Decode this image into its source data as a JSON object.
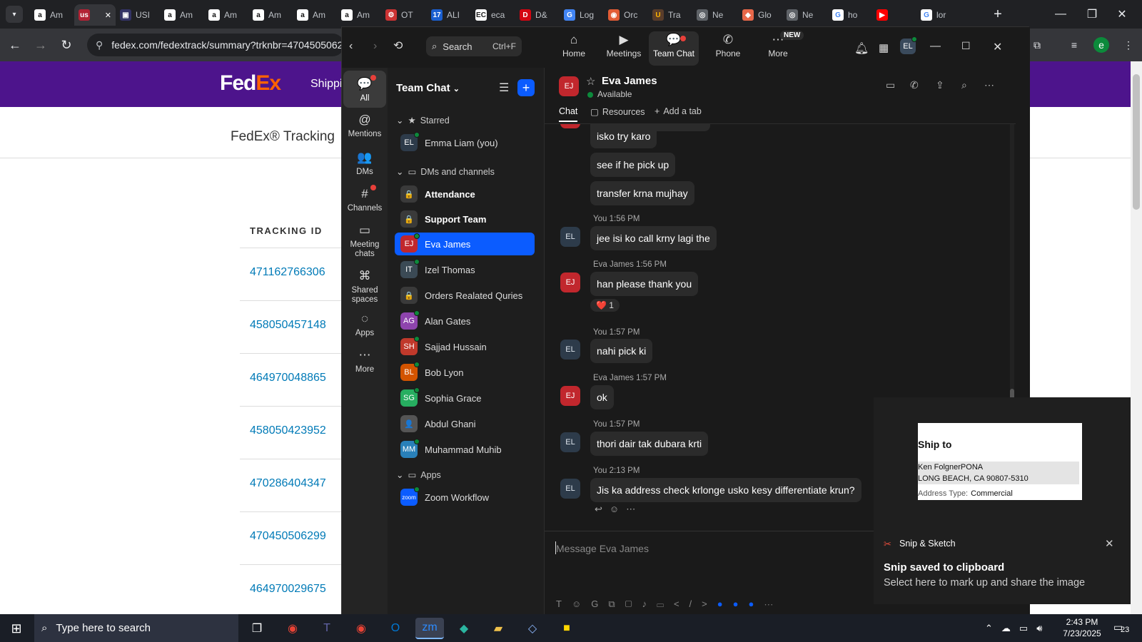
{
  "browser": {
    "tabs": [
      {
        "favicon": "a",
        "fav_bg": "#ffffff",
        "fav_color": "#111111",
        "title": "Am"
      },
      {
        "favicon": "us",
        "fav_bg": "#b22234",
        "fav_color": "#ffffff",
        "title": ""
      },
      {
        "favicon": "▣",
        "fav_bg": "#333366",
        "fav_color": "#ffffff",
        "title": "USI"
      },
      {
        "favicon": "a",
        "fav_bg": "#ffffff",
        "fav_color": "#111111",
        "title": "Am"
      },
      {
        "favicon": "a",
        "fav_bg": "#ffffff",
        "fav_color": "#111111",
        "title": "Am"
      },
      {
        "favicon": "a",
        "fav_bg": "#ffffff",
        "fav_color": "#111111",
        "title": "Am"
      },
      {
        "favicon": "a",
        "fav_bg": "#ffffff",
        "fav_color": "#111111",
        "title": "Am"
      },
      {
        "favicon": "a",
        "fav_bg": "#ffffff",
        "fav_color": "#111111",
        "title": "Am"
      },
      {
        "favicon": "⚙",
        "fav_bg": "#cc3333",
        "fav_color": "#ffffff",
        "title": "OT"
      },
      {
        "favicon": "17",
        "fav_bg": "#1a5fd0",
        "fav_color": "#ffffff",
        "title": "ALI"
      },
      {
        "favicon": "EC",
        "fav_bg": "#ffffff",
        "fav_color": "#222222",
        "title": "eca"
      },
      {
        "favicon": "D",
        "fav_bg": "#d40511",
        "fav_color": "#ffffff",
        "title": "D&"
      },
      {
        "favicon": "G",
        "fav_bg": "#4285f4",
        "fav_color": "#ffffff",
        "title": "Log"
      },
      {
        "favicon": "◉",
        "fav_bg": "#e25c35",
        "fav_color": "#ffffff",
        "title": "Orc"
      },
      {
        "favicon": "U",
        "fav_bg": "#5a3d2b",
        "fav_color": "#ffb500",
        "title": "Tra"
      },
      {
        "favicon": "◎",
        "fav_bg": "#5f6368",
        "fav_color": "#ffffff",
        "title": "Ne"
      },
      {
        "favicon": "◆",
        "fav_bg": "#e8684a",
        "fav_color": "#ffffff",
        "title": "Glo"
      },
      {
        "favicon": "◎",
        "fav_bg": "#5f6368",
        "fav_color": "#ffffff",
        "title": "Ne"
      },
      {
        "favicon": "G",
        "fav_bg": "#ffffff",
        "fav_color": "#4285f4",
        "title": "ho"
      },
      {
        "favicon": "▶",
        "fav_bg": "#ff0000",
        "fav_color": "#ffffff",
        "title": ""
      },
      {
        "favicon": "G",
        "fav_bg": "#ffffff",
        "fav_color": "#4285f4",
        "title": "lor"
      }
    ],
    "url": "fedex.com/fedextrack/summary?trknbr=4704505062",
    "profile_initial": "e"
  },
  "fedex": {
    "logo_fed": "Fed",
    "logo_ex": "Ex",
    "nav_shipping": "Shippi",
    "title": "FedEx® Tracking",
    "column_header": "TRACKING ID",
    "tracking_ids": [
      "471162766306",
      "458050457148",
      "464970048865",
      "458050423952",
      "470286404347",
      "470450506299",
      "464970029675"
    ]
  },
  "zoom": {
    "search_label": "Search",
    "search_shortcut": "Ctrl+F",
    "top_nav": [
      {
        "label": "Home",
        "icon": "⌂"
      },
      {
        "label": "Meetings",
        "icon": "▶"
      },
      {
        "label": "Team Chat",
        "icon": "💬"
      },
      {
        "label": "Phone",
        "icon": "✆"
      },
      {
        "label": "More",
        "icon": "⋯"
      }
    ],
    "new_badge": "NEW",
    "user_initials": "EL",
    "left_nav": [
      {
        "label": "All",
        "icon": "💬"
      },
      {
        "label": "Mentions",
        "icon": "@"
      },
      {
        "label": "DMs",
        "icon": "👥"
      },
      {
        "label": "Channels",
        "icon": "#"
      },
      {
        "label": "Meeting chats",
        "icon": "▭"
      },
      {
        "label": "Shared spaces",
        "icon": "⌘"
      },
      {
        "label": "Apps",
        "icon": "◌"
      },
      {
        "label": "More",
        "icon": "⋯"
      }
    ],
    "panel_title": "Team Chat",
    "sections": {
      "starred": "Starred",
      "dms": "DMs and channels",
      "apps": "Apps"
    },
    "starred_item": {
      "initials": "EL",
      "name": "Emma Liam (you)",
      "color": "#2d3b4a"
    },
    "channels": [
      {
        "initials": "🔒",
        "name": "Attendance",
        "color": "#3a3a3a"
      },
      {
        "initials": "🔒",
        "name": "Support Team",
        "color": "#3a3a3a"
      }
    ],
    "dms": [
      {
        "initials": "EJ",
        "name": "Eva James",
        "color": "#c1272d"
      },
      {
        "initials": "IT",
        "name": "Izel Thomas",
        "color": "#3b4a55"
      },
      {
        "initials": "🔒",
        "name": "Orders Realated Quries",
        "color": "#3a3a3a"
      },
      {
        "initials": "AG",
        "name": "Alan Gates",
        "color": "#8e44ad"
      },
      {
        "initials": "SH",
        "name": "Sajjad Hussain",
        "color": "#c0392b"
      },
      {
        "initials": "BL",
        "name": "Bob Lyon",
        "color": "#d35400"
      },
      {
        "initials": "SG",
        "name": "Sophia Grace",
        "color": "#27ae60"
      },
      {
        "initials": "👤",
        "name": "Abdul Ghani",
        "color": "#555555"
      },
      {
        "initials": "MM",
        "name": "Muhammad Muhib",
        "color": "#2980b9"
      }
    ],
    "apps_item": {
      "initials": "zoom",
      "name": "Zoom Workflow",
      "color": "#0b5cff"
    },
    "chat": {
      "contact_initials": "EJ",
      "contact_name": "Eva James",
      "contact_status": "Available",
      "tabs": [
        "Chat",
        "Resources",
        "Add a tab"
      ],
      "messages": [
        {
          "text": "isko try karo"
        },
        {
          "text": "see if he pick up"
        },
        {
          "text": "transfer krna mujhay"
        },
        {
          "meta": "You 1:56 PM",
          "text": "jee isi ko call krny lagi the"
        },
        {
          "meta": "Eva James 1:56 PM",
          "text": "han please thank you"
        },
        {
          "meta": "You 1:57 PM",
          "text": "nahi pick ki"
        },
        {
          "meta": "Eva James 1:57 PM",
          "text": "ok"
        },
        {
          "meta": "You 1:57 PM",
          "text": "thori dair tak dubara krti"
        },
        {
          "meta": "You 2:13 PM",
          "text": "Jis ka address check krlonge usko kesy differentiate krun?"
        }
      ],
      "reaction": {
        "emoji": "❤️",
        "count": "1"
      },
      "composer_placeholder": "Message Eva James"
    }
  },
  "snip": {
    "image": {
      "heading": "Ship to",
      "line1": "Ken FolgnerPONA",
      "line2": "LONG BEACH, CA 90807-5310",
      "addr_label": "Address Type:",
      "addr_value": "Commercial"
    },
    "app_name": "Snip & Sketch",
    "title": "Snip saved to clipboard",
    "subtitle": "Select here to mark up and share the image"
  },
  "taskbar": {
    "search_placeholder": "Type here to search",
    "time": "2:43 PM",
    "date": "7/23/2025",
    "notif_count": "23"
  }
}
